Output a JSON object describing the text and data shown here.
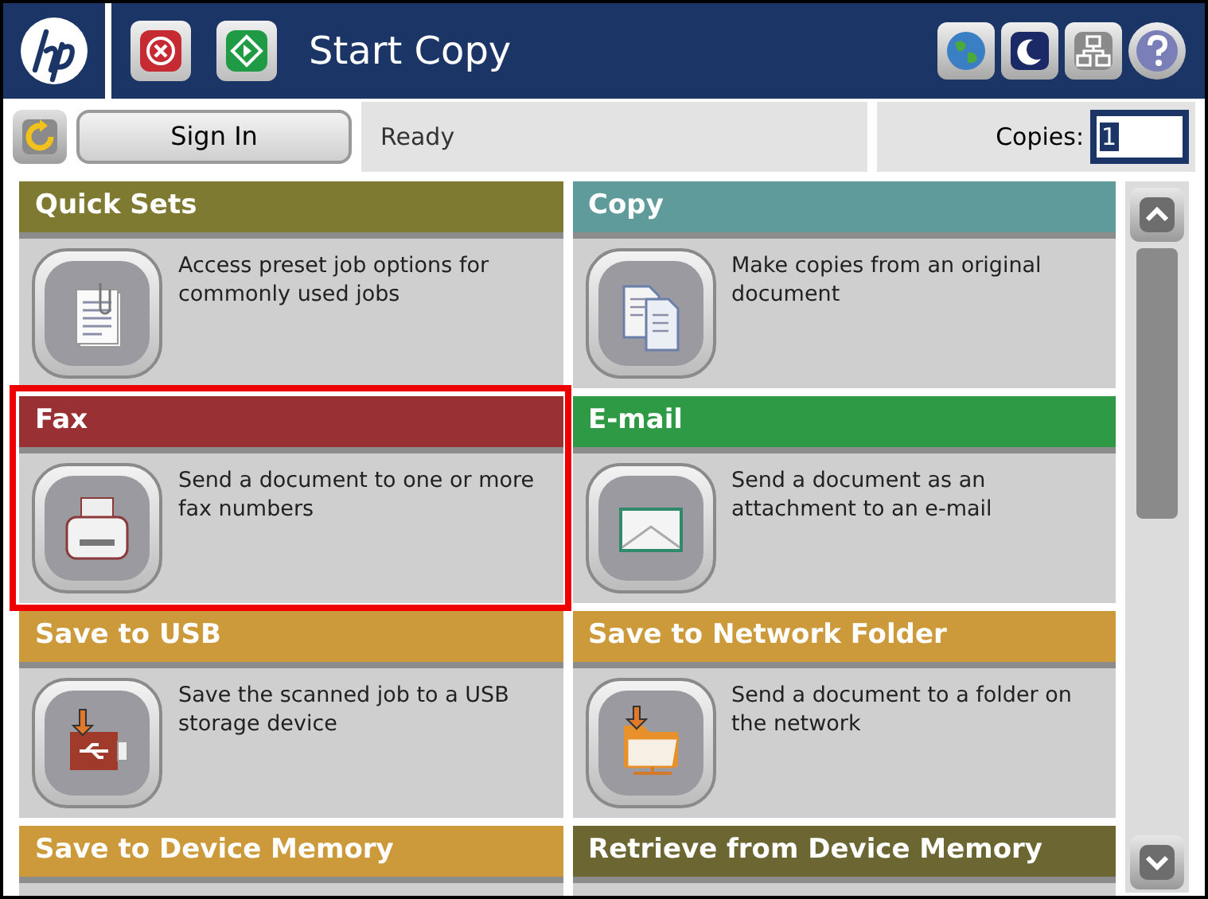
{
  "header": {
    "title": "Start Copy"
  },
  "status_row": {
    "sign_in": "Sign In",
    "status": "Ready",
    "copies_label": "Copies:",
    "copies_value": "1"
  },
  "tiles": [
    {
      "title": "Quick Sets",
      "description": "Access preset job options for commonly used jobs",
      "color": "#7f7a32",
      "highlighted": false
    },
    {
      "title": "Copy",
      "description": "Make copies from an original document",
      "color": "#5f9b9b",
      "highlighted": false
    },
    {
      "title": "Fax",
      "description": "Send a document to one or more fax numbers",
      "color": "#993033",
      "highlighted": true
    },
    {
      "title": "E-mail",
      "description": "Send a document as an attachment to an e-mail",
      "color": "#2f9a45",
      "highlighted": false
    },
    {
      "title": "Save to USB",
      "description": "Save the scanned job to a USB storage device",
      "color": "#cc9a3a",
      "highlighted": false
    },
    {
      "title": "Save to Network Folder",
      "description": "Send a document to a folder on the network",
      "color": "#cc9a3a",
      "highlighted": false
    },
    {
      "title": "Save to Device Memory",
      "color": "#cc9a3a",
      "highlighted": false
    },
    {
      "title": "Retrieve from Device Memory",
      "color": "#6b6632",
      "highlighted": false
    }
  ]
}
